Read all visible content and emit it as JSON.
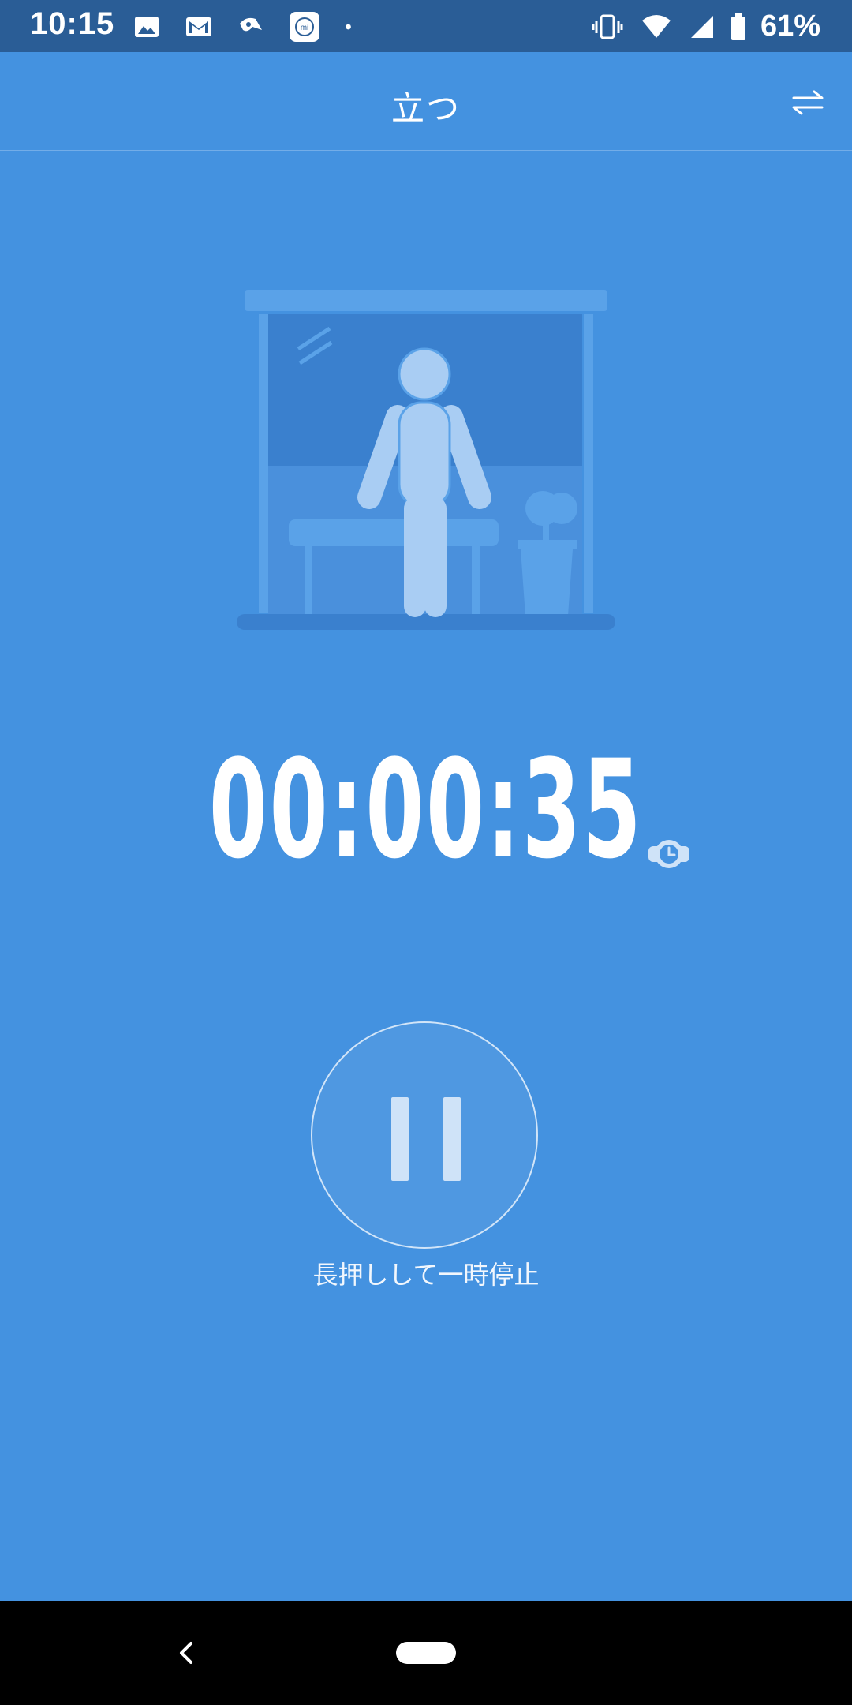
{
  "status_bar": {
    "time": "10:15",
    "battery_percent": "61%",
    "left_icons": [
      "image-icon",
      "gmail-icon",
      "signal-app-icon",
      "mi-fit-icon",
      "dot-icon"
    ],
    "right_icons": [
      "vibrate-icon",
      "wifi-icon",
      "cell-signal-icon",
      "battery-icon"
    ]
  },
  "header": {
    "title": "立つ",
    "action_icon": "swap-arrows-icon"
  },
  "workout": {
    "illustration": "standing-person-illustration",
    "elapsed_time": "00:00:35",
    "watch_icon": "watch-clock-icon"
  },
  "controls": {
    "pause_icon": "pause-icon",
    "hint_text": "長押しして一時停止"
  },
  "nav_bar": {
    "back_icon": "back-chevron-icon",
    "home_icon": "home-pill-icon"
  },
  "colors": {
    "background": "#4492e0",
    "status_bar": "#2a5d96",
    "nav_bar": "#000000",
    "illustration_shade": "#3a80ce",
    "figure_fill": "#a9cdf3"
  }
}
